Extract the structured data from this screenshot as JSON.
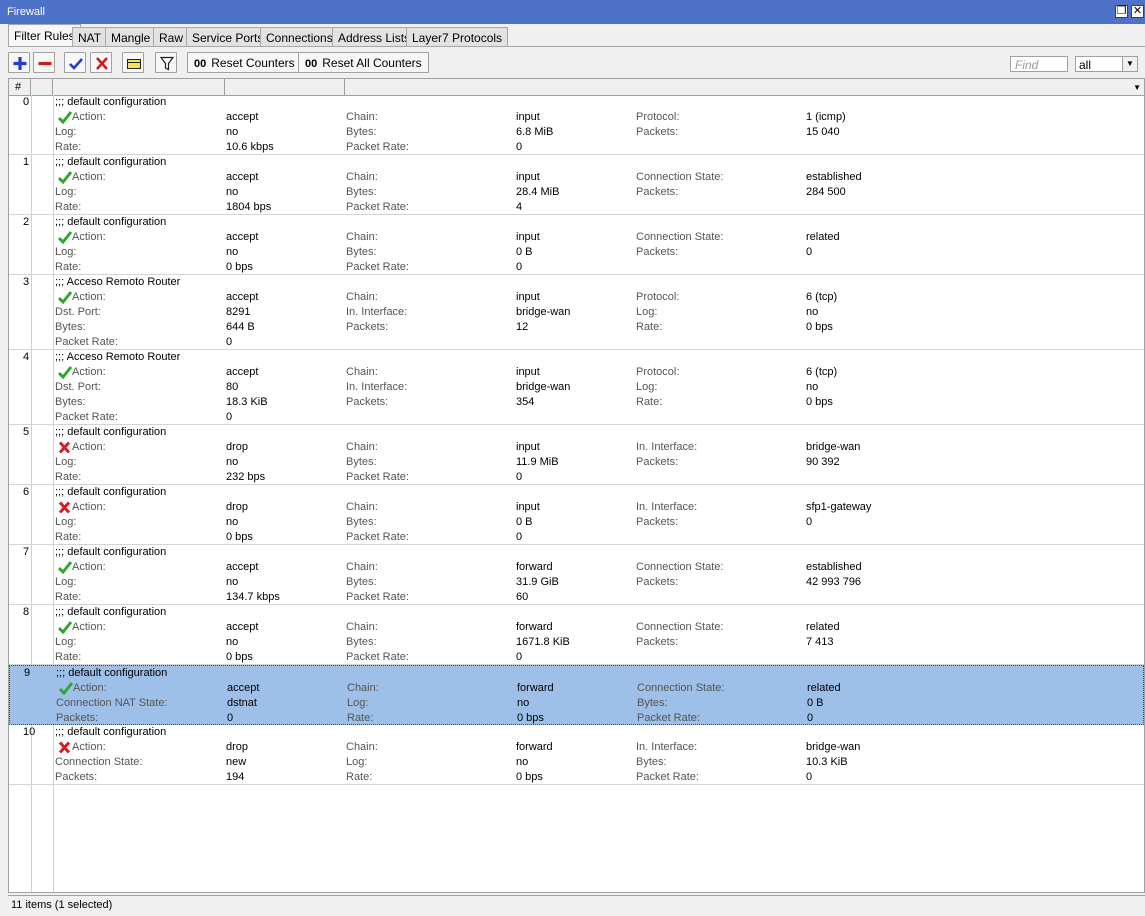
{
  "window": {
    "title": "Firewall"
  },
  "tabs": [
    "Filter Rules",
    "NAT",
    "Mangle",
    "Raw",
    "Service Ports",
    "Connections",
    "Address Lists",
    "Layer7 Protocols"
  ],
  "toolbar": {
    "reset_counters": "Reset Counters",
    "reset_all_counters": "Reset All Counters",
    "counter_glyph": "00",
    "find_placeholder": "Find",
    "filter_value": "all"
  },
  "grid": {
    "header_hash": "#"
  },
  "rules": [
    {
      "num": "0",
      "comment": ";;; default configuration",
      "action_icon": "accept-check-icon",
      "rows": [
        [
          "Action:",
          "accept",
          "Chain:",
          "input",
          "Protocol:",
          "1 (icmp)"
        ],
        [
          "Log:",
          "no",
          "Bytes:",
          "6.8 MiB",
          "Packets:",
          "15 040"
        ],
        [
          "Rate:",
          "10.6 kbps",
          "Packet Rate:",
          "0",
          "",
          ""
        ]
      ]
    },
    {
      "num": "1",
      "comment": ";;; default configuration",
      "action_icon": "accept-check-icon",
      "rows": [
        [
          "Action:",
          "accept",
          "Chain:",
          "input",
          "Connection State:",
          "established"
        ],
        [
          "Log:",
          "no",
          "Bytes:",
          "28.4 MiB",
          "Packets:",
          "284 500"
        ],
        [
          "Rate:",
          "1804 bps",
          "Packet Rate:",
          "4",
          "",
          ""
        ]
      ]
    },
    {
      "num": "2",
      "comment": ";;; default configuration",
      "action_icon": "accept-check-icon",
      "rows": [
        [
          "Action:",
          "accept",
          "Chain:",
          "input",
          "Connection State:",
          "related"
        ],
        [
          "Log:",
          "no",
          "Bytes:",
          "0 B",
          "Packets:",
          "0"
        ],
        [
          "Rate:",
          "0 bps",
          "Packet Rate:",
          "0",
          "",
          ""
        ]
      ]
    },
    {
      "num": "3",
      "comment": ";;; Acceso Remoto Router",
      "action_icon": "accept-check-icon",
      "rows": [
        [
          "Action:",
          "accept",
          "Chain:",
          "input",
          "Protocol:",
          "6 (tcp)"
        ],
        [
          "Dst. Port:",
          "8291",
          "In. Interface:",
          "bridge-wan",
          "Log:",
          "no"
        ],
        [
          "Bytes:",
          "644 B",
          "Packets:",
          "12",
          "Rate:",
          "0 bps"
        ],
        [
          "Packet Rate:",
          "0",
          "",
          "",
          "",
          ""
        ]
      ]
    },
    {
      "num": "4",
      "comment": ";;; Acceso Remoto Router",
      "action_icon": "accept-check-icon",
      "rows": [
        [
          "Action:",
          "accept",
          "Chain:",
          "input",
          "Protocol:",
          "6 (tcp)"
        ],
        [
          "Dst. Port:",
          "80",
          "In. Interface:",
          "bridge-wan",
          "Log:",
          "no"
        ],
        [
          "Bytes:",
          "18.3 KiB",
          "Packets:",
          "354",
          "Rate:",
          "0 bps"
        ],
        [
          "Packet Rate:",
          "0",
          "",
          "",
          "",
          ""
        ]
      ]
    },
    {
      "num": "5",
      "comment": ";;; default configuration",
      "action_icon": "drop-x-icon",
      "rows": [
        [
          "Action:",
          "drop",
          "Chain:",
          "input",
          "In. Interface:",
          "bridge-wan"
        ],
        [
          "Log:",
          "no",
          "Bytes:",
          "11.9 MiB",
          "Packets:",
          "90 392"
        ],
        [
          "Rate:",
          "232 bps",
          "Packet Rate:",
          "0",
          "",
          ""
        ]
      ]
    },
    {
      "num": "6",
      "comment": ";;; default configuration",
      "action_icon": "drop-x-icon",
      "rows": [
        [
          "Action:",
          "drop",
          "Chain:",
          "input",
          "In. Interface:",
          "sfp1-gateway"
        ],
        [
          "Log:",
          "no",
          "Bytes:",
          "0 B",
          "Packets:",
          "0"
        ],
        [
          "Rate:",
          "0 bps",
          "Packet Rate:",
          "0",
          "",
          ""
        ]
      ]
    },
    {
      "num": "7",
      "comment": ";;; default configuration",
      "action_icon": "accept-check-icon",
      "rows": [
        [
          "Action:",
          "accept",
          "Chain:",
          "forward",
          "Connection State:",
          "established"
        ],
        [
          "Log:",
          "no",
          "Bytes:",
          "31.9 GiB",
          "Packets:",
          "42 993 796"
        ],
        [
          "Rate:",
          "134.7 kbps",
          "Packet Rate:",
          "60",
          "",
          ""
        ]
      ]
    },
    {
      "num": "8",
      "comment": ";;; default configuration",
      "action_icon": "accept-check-icon",
      "rows": [
        [
          "Action:",
          "accept",
          "Chain:",
          "forward",
          "Connection State:",
          "related"
        ],
        [
          "Log:",
          "no",
          "Bytes:",
          "1671.8 KiB",
          "Packets:",
          "7 413"
        ],
        [
          "Rate:",
          "0 bps",
          "Packet Rate:",
          "0",
          "",
          ""
        ]
      ]
    },
    {
      "num": "9",
      "comment": ";;; default configuration",
      "action_icon": "accept-check-icon",
      "selected": true,
      "rows": [
        [
          "Action:",
          "accept",
          "Chain:",
          "forward",
          "Connection State:",
          "related"
        ],
        [
          "Connection NAT State:",
          "dstnat",
          "Log:",
          "no",
          "Bytes:",
          "0 B"
        ],
        [
          "Packets:",
          "0",
          "Rate:",
          "0 bps",
          "Packet Rate:",
          "0"
        ]
      ]
    },
    {
      "num": "10",
      "comment": ";;; default configuration",
      "action_icon": "drop-x-icon",
      "rows": [
        [
          "Action:",
          "drop",
          "Chain:",
          "forward",
          "In. Interface:",
          "bridge-wan"
        ],
        [
          "Connection State:",
          "new",
          "Log:",
          "no",
          "Bytes:",
          "10.3 KiB"
        ],
        [
          "Packets:",
          "194",
          "Rate:",
          "0 bps",
          "Packet Rate:",
          "0"
        ]
      ]
    }
  ],
  "status": {
    "text": "11 items (1 selected)"
  },
  "colors": {
    "titlebar": "#4f72c9",
    "selected_row": "#9dbfe8",
    "accept": "#2ea82e",
    "drop": "#d81e1e"
  }
}
